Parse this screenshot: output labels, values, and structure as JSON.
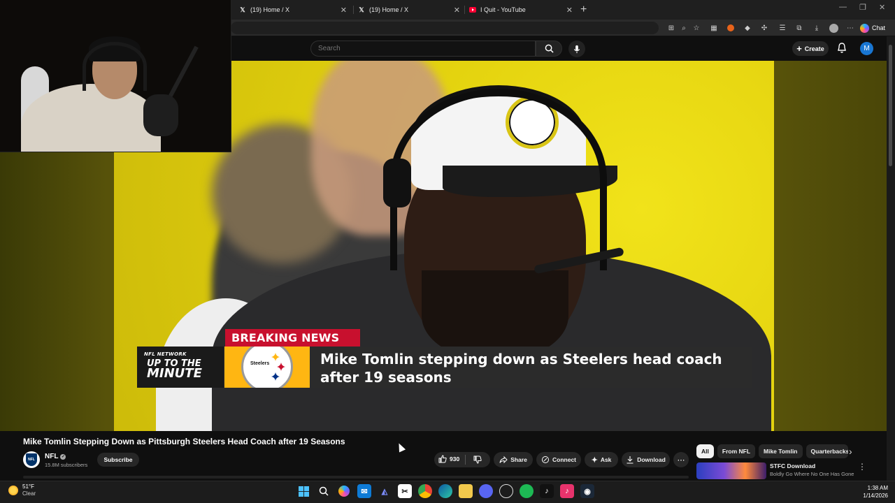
{
  "browser": {
    "tabs": [
      {
        "label": "(19) Home / X",
        "icon": "x-logo-icon"
      },
      {
        "label": "(19) Home / X",
        "icon": "x-logo-icon"
      },
      {
        "label": "I Quit - YouTube",
        "icon": "youtube-icon"
      }
    ],
    "chat_label": "Chat"
  },
  "youtube": {
    "search_placeholder": "Search",
    "create_label": "Create",
    "avatar_initial": "M"
  },
  "video": {
    "breaking_tag": "BREAKING NEWS",
    "brand_network": "NFL NETWORK",
    "brand_line1": "UP TO THE",
    "brand_line2": "MINUTE",
    "logo_word": "Steelers",
    "headline_line1": "Mike Tomlin stepping down as Steelers head coach",
    "headline_line2": "after 19 seasons",
    "title": "Mike Tomlin Stepping Down as Pittsburgh Steelers Head Coach after 19 Seasons",
    "channel_name": "NFL",
    "channel_badge_text": "NFL",
    "subscribers": "15.8M subscribers",
    "subscribe_label": "Subscribe",
    "like_count": "930",
    "share_label": "Share",
    "connect_label": "Connect",
    "ask_label": "Ask",
    "download_label": "Download"
  },
  "sidebar": {
    "chips": [
      "All",
      "From NFL",
      "Mike Tomlin",
      "Quarterbacks"
    ],
    "recommendation": {
      "title": "STFC Download",
      "subtitle": "Boldly Go Where No One Has Gone"
    }
  },
  "taskbar": {
    "weather_temp": "51°F",
    "weather_cond": "Clear",
    "time": "1:38 AM",
    "date": "1/14/2026"
  },
  "colors": {
    "breaking_red": "#c8102e",
    "steelers_gold": "#ffb612",
    "accent_blue": "#1976d2"
  }
}
